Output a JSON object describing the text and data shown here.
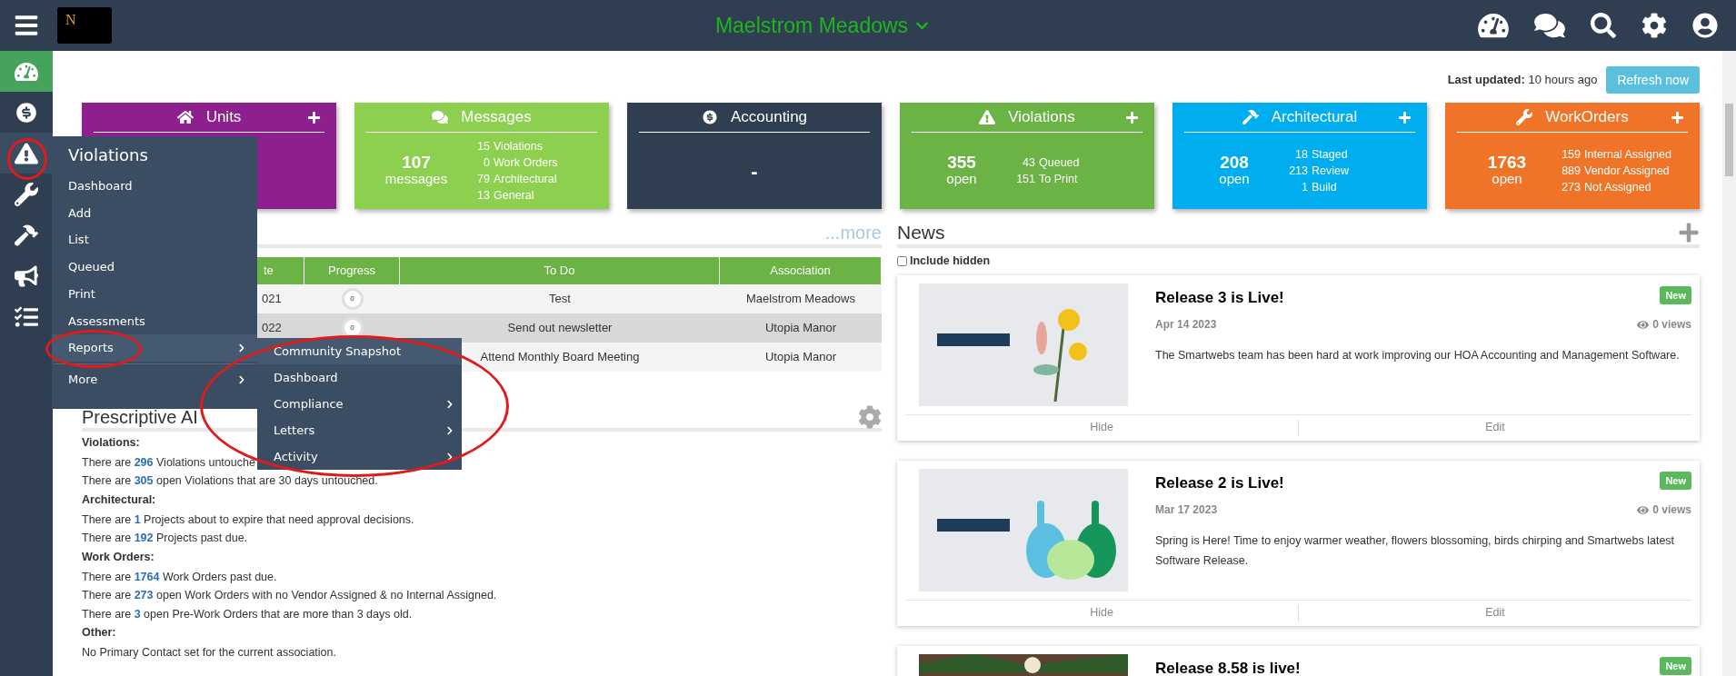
{
  "topbar": {
    "logo_letter": "N",
    "title": "Maelstrom Meadows"
  },
  "sidebar": {
    "items": [
      {
        "kind": "dashboard",
        "selected": true,
        "open": false
      },
      {
        "kind": "accounting",
        "selected": false,
        "open": false
      },
      {
        "kind": "violations",
        "selected": false,
        "open": true
      },
      {
        "kind": "workorders",
        "selected": false,
        "open": false
      },
      {
        "kind": "architectural",
        "selected": false,
        "open": false
      },
      {
        "kind": "announcements",
        "selected": false,
        "open": false
      },
      {
        "kind": "tasks",
        "selected": false,
        "open": false
      }
    ]
  },
  "flyout": {
    "title": "Violations",
    "items": [
      {
        "label": "Dashboard",
        "selected": false,
        "has_submenu": false
      },
      {
        "label": "Add",
        "selected": false,
        "has_submenu": false
      },
      {
        "label": "List",
        "selected": false,
        "has_submenu": false
      },
      {
        "label": "Queued",
        "selected": false,
        "has_submenu": false
      },
      {
        "label": "Print",
        "selected": false,
        "has_submenu": false
      },
      {
        "label": "Assessments",
        "selected": false,
        "has_submenu": false
      },
      {
        "label": "Reports",
        "selected": true,
        "has_submenu": true
      }
    ],
    "footer_item": {
      "label": "More",
      "selected": false,
      "has_submenu": true
    }
  },
  "submenu": {
    "items": [
      {
        "label": "Community Snapshot",
        "selected": true,
        "has_submenu": false
      },
      {
        "label": "Dashboard",
        "selected": false,
        "has_submenu": false
      },
      {
        "label": "Compliance",
        "selected": false,
        "has_submenu": true
      },
      {
        "label": "Letters",
        "selected": false,
        "has_submenu": true
      },
      {
        "label": "Activity",
        "selected": false,
        "has_submenu": true
      }
    ]
  },
  "status": {
    "label": "Last updated:",
    "value": "10 hours ago",
    "button": "Refresh now"
  },
  "cards": [
    {
      "kind": "units",
      "title": "Units",
      "color": "#8e1f8f",
      "has_add": true
    },
    {
      "kind": "messages",
      "title": "Messages",
      "color": "#8dd04f",
      "has_add": false,
      "big_number": "107",
      "big_label": "messages",
      "lines": [
        {
          "count": "15",
          "label": "Violations"
        },
        {
          "count": "0",
          "label": "Work Orders"
        },
        {
          "count": "79",
          "label": "Architectural"
        },
        {
          "count": "13",
          "label": "General"
        }
      ]
    },
    {
      "kind": "accounting",
      "title": "Accounting",
      "color": "#2f3e50",
      "has_add": false,
      "value": "-"
    },
    {
      "kind": "violations",
      "title": "Violations",
      "color": "#6ab344",
      "has_add": true,
      "big_number": "355",
      "big_label": "open",
      "lines": [
        {
          "count": "43",
          "label": "Queued"
        },
        {
          "count": "151",
          "label": "To Print"
        }
      ]
    },
    {
      "kind": "architectural",
      "title": "Architectural",
      "color": "#00adee",
      "has_add": true,
      "big_number": "208",
      "big_label": "open",
      "lines": [
        {
          "count": "18",
          "label": "Staged"
        },
        {
          "count": "213",
          "label": "Review"
        },
        {
          "count": "1",
          "label": "Build"
        }
      ]
    },
    {
      "kind": "workorders",
      "title": "WorkOrders",
      "color": "#f07428",
      "has_add": true,
      "big_number": "1763",
      "big_label": "open",
      "lines": [
        {
          "count": "159",
          "label": "Internal Assigned"
        },
        {
          "count": "889",
          "label": "Vendor Assigned"
        },
        {
          "count": "273",
          "label": "Not Assigned"
        }
      ]
    }
  ],
  "tasks": {
    "more_link": "...more",
    "columns": [
      "te",
      "Progress",
      "To Do",
      "Association"
    ],
    "rows": [
      {
        "column_1": "021",
        "progress": "0",
        "to_do": "Test",
        "association": "Maelstrom Meadows",
        "highlighted": false
      },
      {
        "column_1": "022",
        "progress": "0",
        "to_do": "Send out newsletter",
        "association": "Utopia Manor",
        "highlighted": true
      },
      {
        "to_do": "Attend Monthly Board Meeting",
        "association": "Utopia Manor",
        "highlighted": false
      }
    ]
  },
  "prescriptive": {
    "title": "Prescriptive AI",
    "sections": [
      {
        "heading": "Violations:",
        "lines": [
          {
            "before": "There are ",
            "number": "296",
            "after": " Violations untouche"
          },
          {
            "before": "There are ",
            "number": "305",
            "after": " open Violations that are 30 days untouched."
          }
        ]
      },
      {
        "heading": "Architectural:",
        "lines": [
          {
            "before": "There are ",
            "number": "1",
            "after": " Projects about to expire that need approval decisions."
          },
          {
            "before": "There are ",
            "number": "192",
            "after": " Projects past due."
          }
        ]
      },
      {
        "heading": "Work Orders:",
        "lines": [
          {
            "before": "There are ",
            "number": "1764",
            "after": " Work Orders past due."
          },
          {
            "before": "There are ",
            "number": "273",
            "after": " open Work Orders with no Vendor Assigned & no Internal Assigned."
          },
          {
            "before": "There are ",
            "number": "3",
            "after": " open Pre-Work Orders that are more than 3 days old."
          }
        ]
      },
      {
        "heading": "Other:",
        "lines": [
          {
            "before": "No Primary Contact set for the current association."
          }
        ]
      }
    ]
  },
  "news": {
    "title": "News",
    "include_hidden": {
      "label": "Include hidden",
      "checked": false
    },
    "items": [
      {
        "title": "Release 3 is Live!",
        "date": "Apr 14 2023",
        "views": "0 views",
        "badge": "New",
        "body": "The Smartwebs team has been hard at work improving our HOA Accounting and Management Software.",
        "actions": [
          "Hide",
          "Edit"
        ]
      },
      {
        "title": "Release 2 is Live!",
        "date": "Mar 17 2023",
        "views": "0 views",
        "badge": "New",
        "body": "Spring is Here! Time to enjoy warmer weather, flowers blossoming, birds chirping  and Smartwebs latest Software Release.",
        "actions": [
          "Hide",
          "Edit"
        ]
      },
      {
        "title": "Release 8.58 is live!",
        "badge": "New"
      }
    ]
  }
}
